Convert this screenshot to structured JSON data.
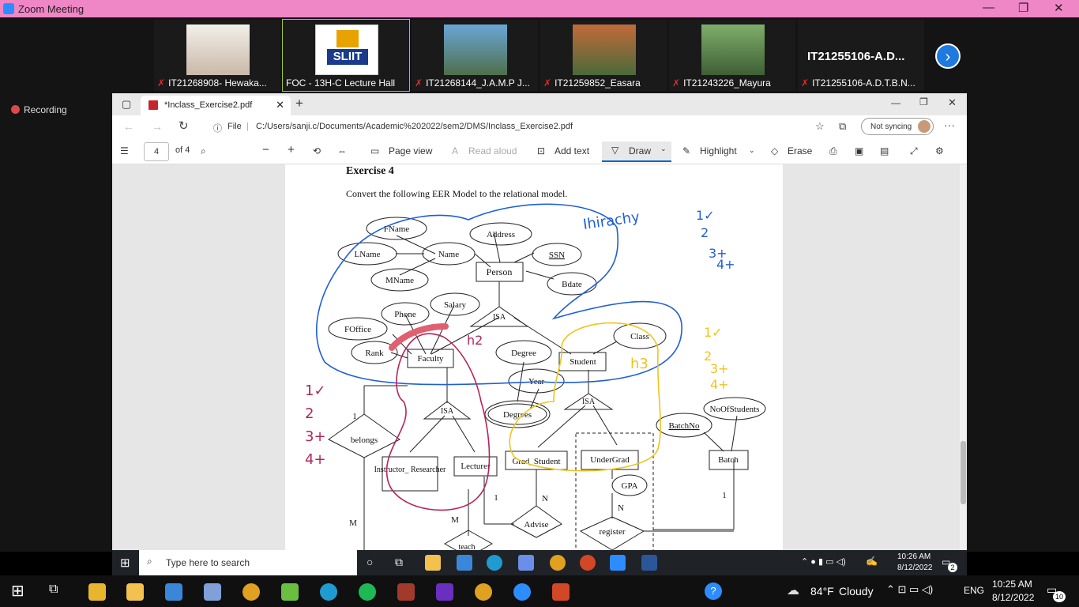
{
  "zoom": {
    "title": "Zoom Meeting",
    "recording": "Recording",
    "participants": [
      {
        "name": "IT21268908- Hewaka...",
        "muted": true
      },
      {
        "name": "FOC - 13H-C Lecture Hall",
        "muted": false,
        "logo_text": "SLIIT"
      },
      {
        "name": "IT21268144_J.A.M.P J...",
        "muted": true
      },
      {
        "name": "IT21259852_Easara",
        "muted": true
      },
      {
        "name": "IT21243226_Mayura",
        "muted": true
      },
      {
        "name": "IT21255106-A.D.T.B.N...",
        "muted": true,
        "header": "IT21255106-A.D..."
      }
    ]
  },
  "browser": {
    "tab_title": "*Inclass_Exercise2.pdf",
    "file_label": "File",
    "url": "C:/Users/sanji.c/Documents/Academic%202022/sem2/DMS/Inclass_Exercise2.pdf",
    "sync_label": "Not syncing"
  },
  "pdf_toolbar": {
    "page": "4",
    "of": "of 4",
    "page_view": "Page view",
    "read_aloud": "Read aloud",
    "add_text": "Add text",
    "draw": "Draw",
    "highlight": "Highlight",
    "erase": "Erase"
  },
  "document": {
    "heading": "Exercise 4",
    "instruction": "Convert the following EER Model to the relational model.",
    "entities": [
      "Person",
      "Faculty",
      "Student",
      "Instructor_ Researcher",
      "Lecturer",
      "Grad_Student",
      "UnderGrad",
      "Batch"
    ],
    "attributes": [
      "FName",
      "LName",
      "MName",
      "Name",
      "Address",
      "SSN",
      "Bdate",
      "Phone",
      "Salary",
      "FOffice",
      "Rank",
      "Degree",
      "Year",
      "Degrees",
      "Class",
      "NoOfStudents",
      "BatchNo",
      "GPA"
    ],
    "relationships": [
      "belongs",
      "Advise",
      "register",
      "teach"
    ],
    "isa": [
      "ISA",
      "ISA",
      "ISA"
    ],
    "cardinalities": [
      "1",
      "M",
      "1",
      "N",
      "M",
      "N",
      "1"
    ],
    "annotations": {
      "hierarchy": "Ihirachy",
      "h2": "h2",
      "h3": "h3",
      "list_a": [
        "1✓",
        "2",
        "3+",
        "4+"
      ],
      "list_b": [
        "1✓",
        "2",
        "3+",
        "4+"
      ],
      "list_c": [
        "1✓",
        "2",
        "3+",
        "4+"
      ]
    }
  },
  "remote_taskbar": {
    "search": "Type here to search",
    "time": "10:26 AM",
    "date": "8/12/2022",
    "notif": "2"
  },
  "local_taskbar": {
    "weather_temp": "84°F",
    "weather_desc": "Cloudy",
    "lang": "ENG",
    "time": "10:25 AM",
    "date": "8/12/2022",
    "notif": "10"
  },
  "colors": {
    "zoom_title_bg": "#ef86c6",
    "blue_ink": "#1f5fd6",
    "yellow_ink": "#f0c419",
    "red_ink": "#b5245a"
  }
}
